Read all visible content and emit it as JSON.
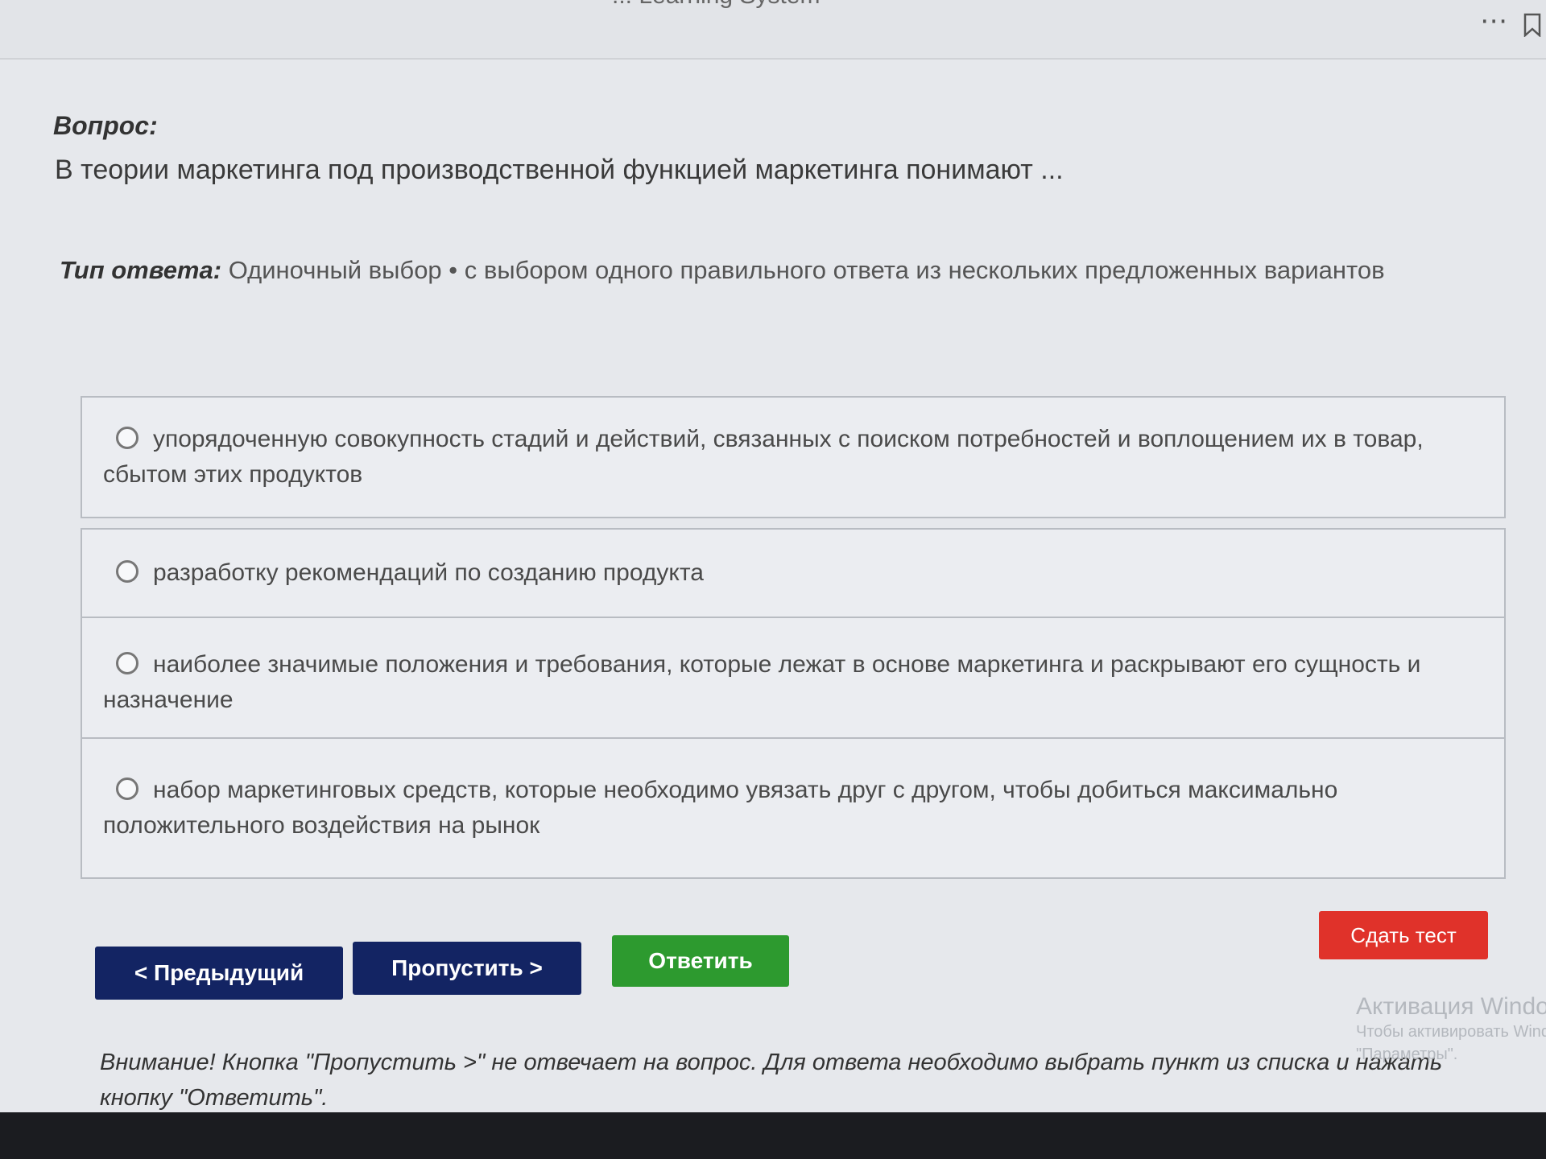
{
  "header": {
    "app_title": "... Learning System",
    "more_icon": "more-horizontal-icon",
    "bookmark_icon": "bookmark-icon"
  },
  "question": {
    "label": "Вопрос:",
    "text": "В теории маркетинга под производственной функцией маркетинга понимают ..."
  },
  "answer_type": {
    "label": "Тип ответа:",
    "value": "Одиночный выбор • с выбором одного правильного ответа из нескольких предложенных вариантов"
  },
  "options": [
    {
      "text": "упорядоченную совокупность стадий и действий, связанных с поиском потребностей и воплощением их в товар, сбытом этих продуктов",
      "selected": false
    },
    {
      "text": "разработку рекомендаций по созданию продукта",
      "selected": false
    },
    {
      "text": "наиболее значимые положения и требования, которые лежат в основе маркетинга и раскрывают его сущность и назначение",
      "selected": false
    },
    {
      "text": "набор маркетинговых средств, которые необходимо увязать друг с другом, чтобы добиться максимально положительного воздействия на рынок",
      "selected": false
    }
  ],
  "buttons": {
    "prev": "< Предыдущий",
    "skip": "Пропустить >",
    "answer": "Ответить",
    "submit": "Сдать тест"
  },
  "colors": {
    "nav_button": "#132463",
    "answer_button": "#2d9a2f",
    "submit_button": "#e0322a"
  },
  "notice": "Внимание! Кнопка \"Пропустить >\" не отвечает на вопрос. Для ответа необходимо выбрать пункт из списка и нажать кнопку \"Ответить\".",
  "watermark": {
    "title": "Активация Windows",
    "line1": "Чтобы активировать Windows,",
    "line2": "\"Параметры\"."
  }
}
